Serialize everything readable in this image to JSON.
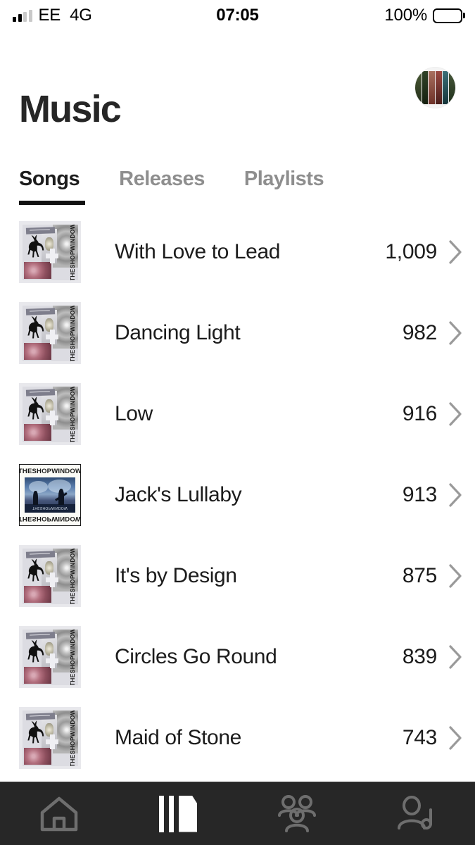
{
  "statusbar": {
    "carrier": "EE",
    "network": "4G",
    "time": "07:05",
    "battery_percent": "100%",
    "signal_bars_total": 4,
    "signal_bars_filled": 2
  },
  "header": {
    "title": "Music",
    "avatar_name": "profile-avatar",
    "avatar_strip_colors": [
      "#3f4a2e",
      "#2d3d24",
      "#6b3b33",
      "#9c5247",
      "#2f5a5e",
      "#3d4f33"
    ]
  },
  "tabs": [
    {
      "label": "Songs",
      "active": true
    },
    {
      "label": "Releases",
      "active": false
    },
    {
      "label": "Playlists",
      "active": false
    }
  ],
  "songs": [
    {
      "title": "With Love to Lead",
      "count": "1,009",
      "artwork": "deer-roses"
    },
    {
      "title": "Dancing Light",
      "count": "982",
      "artwork": "deer-roses"
    },
    {
      "title": "Low",
      "count": "916",
      "artwork": "deer-roses"
    },
    {
      "title": "Jack's Lullaby",
      "count": "913",
      "artwork": "theshopwindow-blue"
    },
    {
      "title": "It's by Design",
      "count": "875",
      "artwork": "deer-roses"
    },
    {
      "title": "Circles Go Round",
      "count": "839",
      "artwork": "deer-roses"
    },
    {
      "title": "Maid of Stone",
      "count": "743",
      "artwork": "deer-roses"
    }
  ],
  "artwork_text": {
    "vertical_label": "THESHOPWINDOW",
    "top_caption": "THESHOPWINDOW",
    "bottom_caption": "THESHOPWINDOW",
    "photo_caption": "THESHOPWINDOW"
  },
  "bottom_nav": [
    {
      "name": "home",
      "label": "Home",
      "active": false
    },
    {
      "name": "library",
      "label": "Library",
      "active": true
    },
    {
      "name": "groups",
      "label": "Groups",
      "active": false
    },
    {
      "name": "artist",
      "label": "Artist",
      "active": false
    }
  ],
  "colors": {
    "background": "#ffffff",
    "text_primary": "#1c1c1c",
    "text_muted": "#8e8e8e",
    "chevron": "#9a9a9a",
    "navbar_bg": "#272727",
    "nav_icon_inactive": "#6e6e6e",
    "nav_icon_active": "#ffffff",
    "tab_underline": "#111111"
  }
}
